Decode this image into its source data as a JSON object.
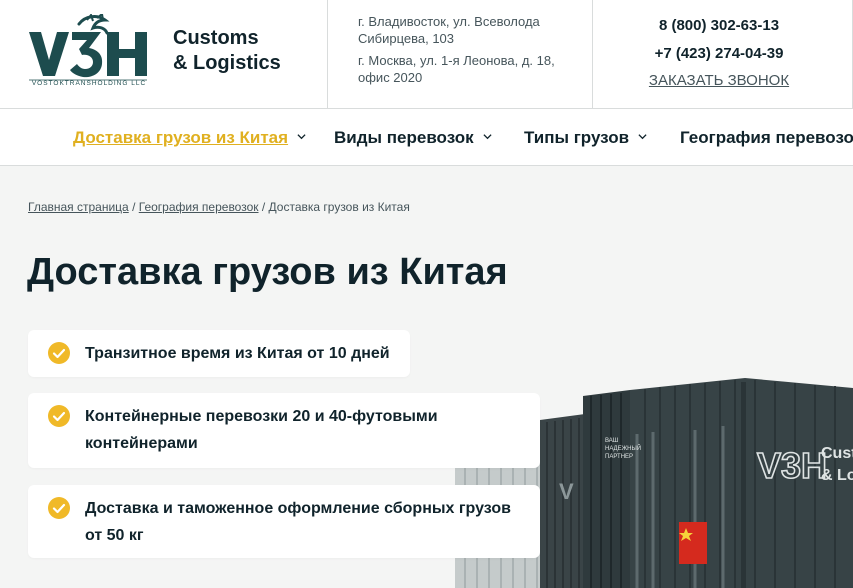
{
  "header": {
    "logo_text": "V3H",
    "logo_subtext": "VOSTOKTRANSHOLDING LLC",
    "brand_line1": "Customs",
    "brand_line2": "& Logistics",
    "address_vladivostok": "г. Владивосток, ул. Всеволода Сибирцева, 103",
    "address_moscow": "г. Москва, ул. 1-я Леонова, д. 18, офис 2020",
    "phone_1": "8 (800) 302-63-13",
    "phone_2": "+7 (423) 274-04-39",
    "callback_label": "ЗАКАЗАТЬ ЗВОНОК"
  },
  "nav": {
    "items": [
      {
        "label": "Доставка грузов из Китая",
        "active": true
      },
      {
        "label": "Виды перевозок",
        "active": false
      },
      {
        "label": "Типы грузов",
        "active": false
      },
      {
        "label": "География перевозок",
        "active": false
      }
    ]
  },
  "breadcrumb": {
    "home": "Главная страница",
    "separator": " / ",
    "section": "География перевозок",
    "current": "Доставка грузов из Китая"
  },
  "main": {
    "title": "Доставка грузов из Китая",
    "features": [
      {
        "line1": "Транзитное время из Китая от 10 дней",
        "line2": ""
      },
      {
        "line1": "Контейнерные перевозки 20 и 40-футовыми",
        "line2": "контейнерами"
      },
      {
        "line1": "Доставка и таможенное оформление сборных грузов",
        "line2": "от 50 кг"
      }
    ],
    "container_brand_right": "Cust",
    "container_brand_right2": "& Lo",
    "container_text_1": "ВАШ",
    "container_text_2": "НАДЕЖНЫЙ",
    "container_text_3": "ПАРТНЕР"
  },
  "colors": {
    "accent": "#e0b020",
    "dark": "#10232b",
    "logo_green": "#1d4c4e",
    "check_yellow": "#f0b928",
    "background": "#f4f5f4"
  },
  "icons": {
    "nav_chevron": "chevron-down-icon",
    "feature_check": "check-circle-icon"
  }
}
